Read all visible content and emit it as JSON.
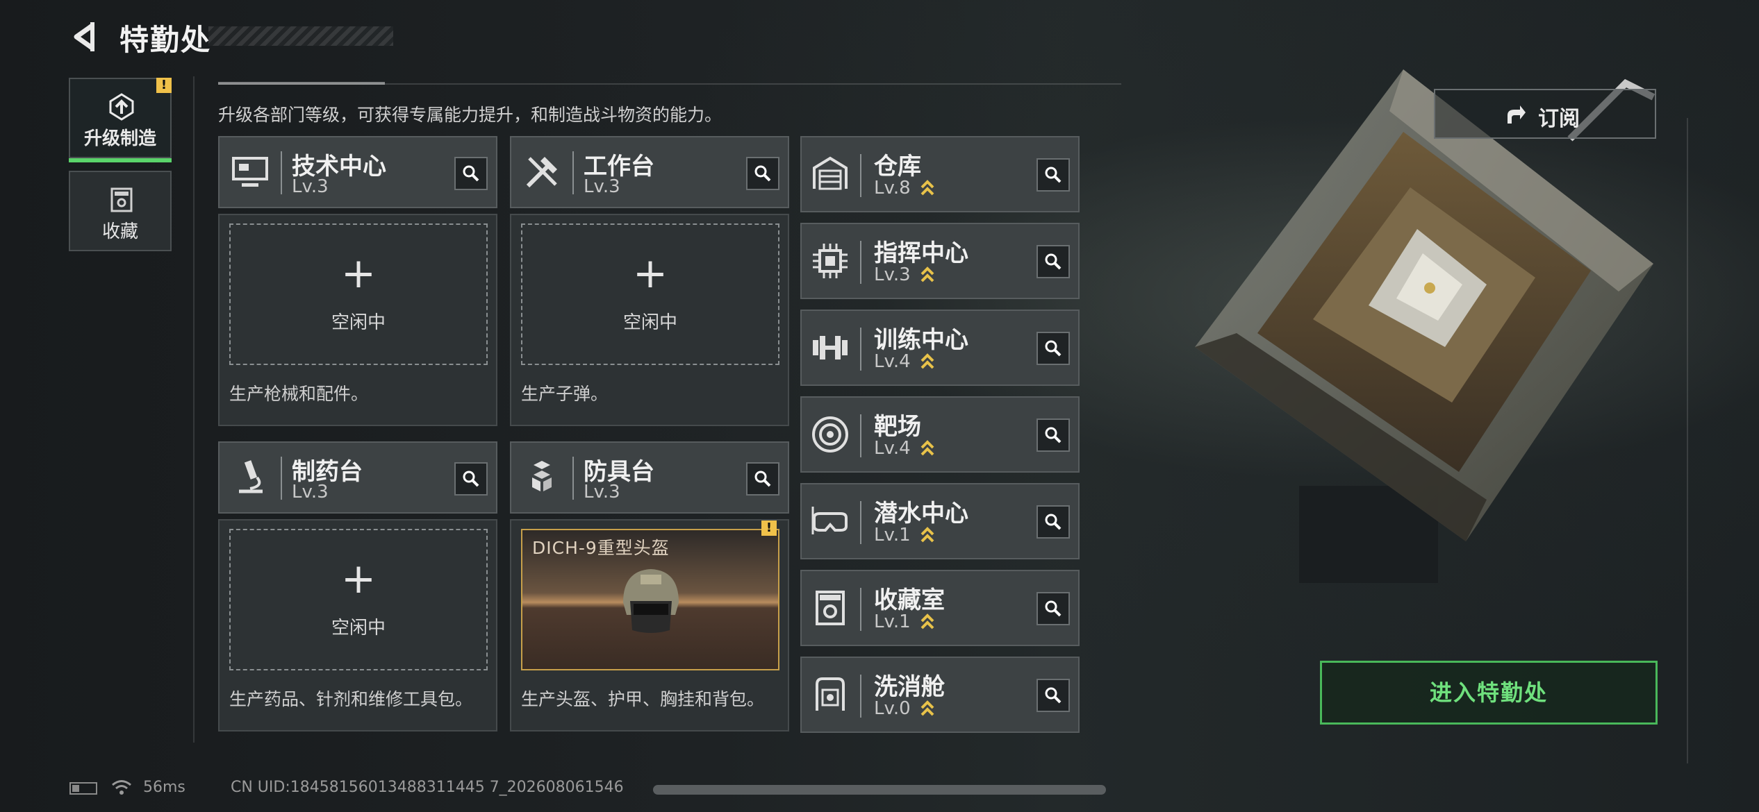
{
  "header": {
    "title": "特勤处"
  },
  "sidebar": {
    "items": [
      {
        "label": "升级制造",
        "active": true,
        "badge": "!"
      },
      {
        "label": "收藏",
        "active": false
      }
    ]
  },
  "subtitle": "升级各部门等级，可获得专属能力提升，和制造战斗物资的能力。",
  "subscribe_label": "订阅",
  "enter_label": "进入特勤处",
  "cards": [
    {
      "name": "技术中心",
      "level": "Lv.3",
      "icon": "computer-icon",
      "status": "空闲中",
      "desc": "生产枪械和配件。"
    },
    {
      "name": "工作台",
      "level": "Lv.3",
      "icon": "tools-icon",
      "status": "空闲中",
      "desc": "生产子弹。"
    },
    {
      "name": "制药台",
      "level": "Lv.3",
      "icon": "microscope-icon",
      "status": "空闲中",
      "desc": "生产药品、针剂和维修工具包。"
    },
    {
      "name": "防具台",
      "level": "Lv.3",
      "icon": "armor-blocks-icon",
      "producing": "DICH-9重型头盔",
      "badge": "!",
      "desc": "生产头盔、护甲、胸挂和背包。"
    }
  ],
  "facilities": [
    {
      "name": "仓库",
      "level": "Lv.8",
      "icon": "warehouse-icon",
      "upgradable": true
    },
    {
      "name": "指挥中心",
      "level": "Lv.3",
      "icon": "chip-icon",
      "upgradable": true
    },
    {
      "name": "训练中心",
      "level": "Lv.4",
      "icon": "dumbbell-icon",
      "upgradable": true
    },
    {
      "name": "靶场",
      "level": "Lv.4",
      "icon": "target-icon",
      "upgradable": true
    },
    {
      "name": "潜水中心",
      "level": "Lv.1",
      "icon": "diving-mask-icon",
      "upgradable": true
    },
    {
      "name": "收藏室",
      "level": "Lv.1",
      "icon": "collection-icon",
      "upgradable": true
    },
    {
      "name": "洗消舱",
      "level": "Lv.0",
      "icon": "decontamination-icon",
      "upgradable": true
    }
  ],
  "status_bar": {
    "ping": "56ms",
    "uid": "CN UID:18458156013488311445 7_202608061546"
  },
  "colors": {
    "accent_green": "#5ad46a",
    "upgrade_gold": "#e8c24a",
    "warning": "#f0c14a"
  }
}
